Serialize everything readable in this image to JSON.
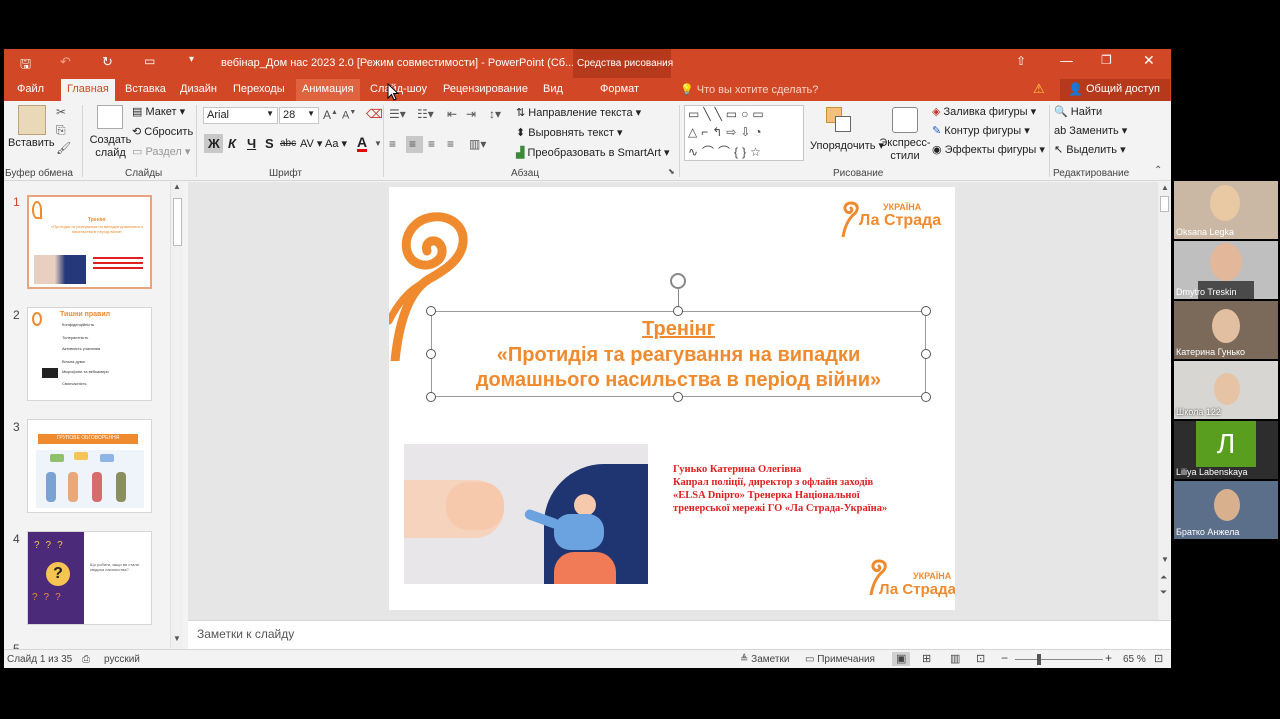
{
  "titlebar": {
    "doc_title": "вебінар_Дом нас 2023 2.0 [Режим совместимости] - PowerPoint (Сб...",
    "drawing_tools": "Средства рисования"
  },
  "tabs": [
    "Файл",
    "Главная",
    "Вставка",
    "Дизайн",
    "Переходы",
    "Анимация",
    "Слайд-шоу",
    "Рецензирование",
    "Вид",
    "Формат"
  ],
  "tellme": "Что вы хотите сделать?",
  "share": "Общий доступ",
  "ribbon": {
    "paste": "Вставить",
    "new_slide": "Создать слайд",
    "layout": "Макет",
    "reset": "Сбросить",
    "section": "Раздел",
    "font_name": "Arial",
    "font_size": "28",
    "bold": "Ж",
    "italic": "К",
    "underline": "Ч",
    "shadow": "S",
    "strike": "abc",
    "spacing": "AV",
    "case": "Aa",
    "text_direction": "Направление текста",
    "align_text": "Выровнять текст",
    "smartart": "Преобразовать в SmartArt",
    "arrange": "Упорядочить",
    "quick_styles": "Экспресс-стили",
    "shape_fill": "Заливка фигуры",
    "shape_outline": "Контур фигуры",
    "shape_effects": "Эффекты фигуры",
    "find": "Найти",
    "replace": "Заменить",
    "select": "Выделить",
    "groups": {
      "clipboard": "Буфер обмена",
      "slides": "Слайды",
      "font": "Шрифт",
      "paragraph": "Абзац",
      "drawing": "Рисование",
      "editing": "Редактирование"
    }
  },
  "thumbnails": [
    {
      "num": "1",
      "title": "Тренінг",
      "subtitle": "«Протидія та реагування на випадки домашнього насильства в період війни»"
    },
    {
      "num": "2",
      "title": "Тишни правил",
      "items": [
        "Конфіденційність",
        "Толерантність",
        "Активність учасників",
        "Вільна дума",
        "Мікрофони та вебкамери",
        "Своєчасність"
      ]
    },
    {
      "num": "3",
      "title": "ГРУПОВЕ ОБГОВОРЕННЯ"
    },
    {
      "num": "4",
      "title": "Що робити, якщо ви стали свідком насильства?"
    },
    {
      "num": "5"
    }
  ],
  "slide": {
    "title_line1": "Тренінг",
    "title_line2": "«Протидія та реагування на випадки",
    "title_line3": "домашнього насильства в період війни»",
    "logo_small": "УКРАЇНА",
    "logo_main": "Ла Страда",
    "author_line1": "Гунько Катерина Олегівна",
    "author_line2": "Капрал поліції, директор з офлайн заходів",
    "author_line3": "«ELSA Dnipro» Тренерка Національної",
    "author_line4": "тренерської мережі ГО «Ла Страда-Україна»"
  },
  "notes": "Заметки к слайду",
  "status": {
    "slide_count": "Слайд 1 из 35",
    "language": "русский",
    "notes_btn": "Заметки",
    "comments_btn": "Примечания",
    "zoom": "65 %"
  },
  "participants": [
    {
      "name": "Oksana Legka"
    },
    {
      "name": "Dmytro Treskin"
    },
    {
      "name": "Катерина Гунько"
    },
    {
      "name": "Школа 122"
    },
    {
      "name": "Liliya Labenskaya",
      "initial": "Л"
    },
    {
      "name": "Братко Анжела"
    }
  ],
  "colors": {
    "accent": "#d24726",
    "slide_orange": "#f08a2e",
    "author_red": "#e02020",
    "avatar_green": "#5a9e1f"
  }
}
